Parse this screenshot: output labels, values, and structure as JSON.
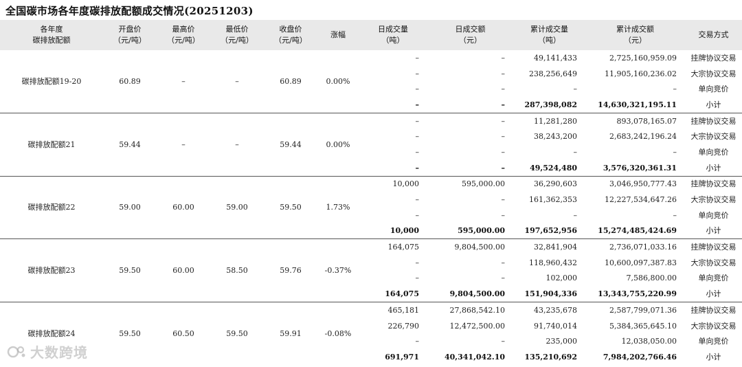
{
  "title": "全国碳市场各年度碳排放配额成交情况(20251203)",
  "headers": {
    "year": [
      "各年度",
      "碳排放配额"
    ],
    "open": [
      "开盘价",
      "（元/吨）"
    ],
    "high": [
      "最高价",
      "（元/吨）"
    ],
    "low": [
      "最低价",
      "（元/吨）"
    ],
    "close": [
      "收盘价",
      "（元/吨）"
    ],
    "change": [
      "涨幅"
    ],
    "day_vol": [
      "日成交量",
      "（吨）"
    ],
    "day_amt": [
      "日成交额",
      "（元）"
    ],
    "cum_vol": [
      "累计成交量",
      "（吨）"
    ],
    "cum_amt": [
      "累计成交额",
      "（元）"
    ],
    "method": [
      "交易方式"
    ]
  },
  "groups": [
    {
      "name": "碳排放配额19-20",
      "open": "60.89",
      "high": "–",
      "low": "–",
      "close": "60.89",
      "change": "0.00%",
      "rows": [
        {
          "day_vol": "–",
          "day_amt": "–",
          "cum_vol": "49,141,433",
          "cum_amt": "2,725,160,959.09",
          "method": "挂牌协议交易"
        },
        {
          "day_vol": "–",
          "day_amt": "–",
          "cum_vol": "238,256,649",
          "cum_amt": "11,905,160,236.02",
          "method": "大宗协议交易"
        },
        {
          "day_vol": "–",
          "day_amt": "–",
          "cum_vol": "–",
          "cum_amt": "–",
          "method": "单向竞价"
        },
        {
          "day_vol": "–",
          "day_amt": "–",
          "cum_vol": "287,398,082",
          "cum_amt": "14,630,321,195.11",
          "method": "小计"
        }
      ]
    },
    {
      "name": "碳排放配额21",
      "open": "59.44",
      "high": "–",
      "low": "–",
      "close": "59.44",
      "change": "0.00%",
      "rows": [
        {
          "day_vol": "–",
          "day_amt": "–",
          "cum_vol": "11,281,280",
          "cum_amt": "893,078,165.07",
          "method": "挂牌协议交易"
        },
        {
          "day_vol": "–",
          "day_amt": "–",
          "cum_vol": "38,243,200",
          "cum_amt": "2,683,242,196.24",
          "method": "大宗协议交易"
        },
        {
          "day_vol": "–",
          "day_amt": "–",
          "cum_vol": "–",
          "cum_amt": "–",
          "method": "单向竞价"
        },
        {
          "day_vol": "–",
          "day_amt": "–",
          "cum_vol": "49,524,480",
          "cum_amt": "3,576,320,361.31",
          "method": "小计"
        }
      ]
    },
    {
      "name": "碳排放配额22",
      "open": "59.00",
      "high": "60.00",
      "low": "59.00",
      "close": "59.50",
      "change": "1.73%",
      "rows": [
        {
          "day_vol": "10,000",
          "day_amt": "595,000.00",
          "cum_vol": "36,290,603",
          "cum_amt": "3,046,950,777.43",
          "method": "挂牌协议交易"
        },
        {
          "day_vol": "–",
          "day_amt": "–",
          "cum_vol": "161,362,353",
          "cum_amt": "12,227,534,647.26",
          "method": "大宗协议交易"
        },
        {
          "day_vol": "–",
          "day_amt": "–",
          "cum_vol": "–",
          "cum_amt": "–",
          "method": "单向竞价"
        },
        {
          "day_vol": "10,000",
          "day_amt": "595,000.00",
          "cum_vol": "197,652,956",
          "cum_amt": "15,274,485,424.69",
          "method": "小计"
        }
      ]
    },
    {
      "name": "碳排放配额23",
      "open": "59.50",
      "high": "60.00",
      "low": "58.50",
      "close": "59.76",
      "change": "-0.37%",
      "rows": [
        {
          "day_vol": "164,075",
          "day_amt": "9,804,500.00",
          "cum_vol": "32,841,904",
          "cum_amt": "2,736,071,033.16",
          "method": "挂牌协议交易"
        },
        {
          "day_vol": "–",
          "day_amt": "–",
          "cum_vol": "118,960,432",
          "cum_amt": "10,600,097,387.83",
          "method": "大宗协议交易"
        },
        {
          "day_vol": "–",
          "day_amt": "–",
          "cum_vol": "102,000",
          "cum_amt": "7,586,800.00",
          "method": "单向竞价"
        },
        {
          "day_vol": "164,075",
          "day_amt": "9,804,500.00",
          "cum_vol": "151,904,336",
          "cum_amt": "13,343,755,220.99",
          "method": "小计"
        }
      ]
    },
    {
      "name": "碳排放配额24",
      "open": "59.50",
      "high": "60.50",
      "low": "59.50",
      "close": "59.91",
      "change": "-0.08%",
      "rows": [
        {
          "day_vol": "465,181",
          "day_amt": "27,868,542.10",
          "cum_vol": "43,235,678",
          "cum_amt": "2,587,799,071.36",
          "method": "挂牌协议交易"
        },
        {
          "day_vol": "226,790",
          "day_amt": "12,472,500.00",
          "cum_vol": "91,740,014",
          "cum_amt": "5,384,365,645.10",
          "method": "大宗协议交易"
        },
        {
          "day_vol": "–",
          "day_amt": "–",
          "cum_vol": "235,000",
          "cum_amt": "12,038,050.00",
          "method": "单向竞价"
        },
        {
          "day_vol": "691,971",
          "day_amt": "40,341,042.10",
          "cum_vol": "135,210,692",
          "cum_amt": "7,984,202,766.46",
          "method": "小计"
        }
      ]
    }
  ],
  "watermark": "大数跨境"
}
